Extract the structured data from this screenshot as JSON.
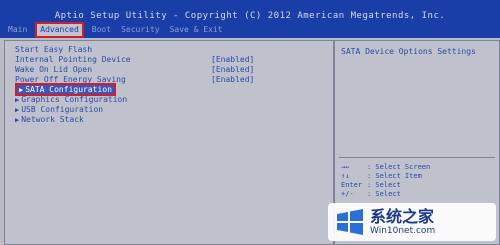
{
  "title": "Aptio Setup Utility - Copyright (C) 2012 American Megatrends, Inc.",
  "tabs": [
    {
      "label": "Main",
      "active": false
    },
    {
      "label": "Advanced",
      "active": true
    },
    {
      "label": "Boot",
      "active": false
    },
    {
      "label": "Security",
      "active": false
    },
    {
      "label": "Save & Exit",
      "active": false
    }
  ],
  "menu": {
    "items": [
      {
        "label": "Start Easy Flash",
        "value": ""
      },
      {
        "label": "Internal Pointing Device",
        "value": "[Enabled]"
      },
      {
        "label": "Wake On Lid Open",
        "value": "[Enabled]"
      },
      {
        "label": "Power Off Energy Saving",
        "value": "[Enabled]"
      },
      {
        "label": "SATA Configuration",
        "value": "",
        "selected": true
      },
      {
        "label": "Graphics Configuration",
        "value": ""
      },
      {
        "label": "USB Configuration",
        "value": ""
      },
      {
        "label": "Network Stack",
        "value": ""
      }
    ]
  },
  "help": {
    "title": "SATA Device Options Settings",
    "keys": [
      {
        "key": "→←",
        "desc": ": Select Screen"
      },
      {
        "key": "↑↓",
        "desc": ": Select Item"
      },
      {
        "key": "Enter",
        "desc": ": Select"
      },
      {
        "key": "+/-",
        "desc": ": Select"
      }
    ]
  },
  "watermark": {
    "main": "系统之家",
    "sub": "Win10net.com"
  },
  "colors": {
    "header_bg": "#1a3ea8",
    "panel_bg": "#bfc2cc",
    "text": "#2a4aa8",
    "highlight": "#d11f2a"
  }
}
